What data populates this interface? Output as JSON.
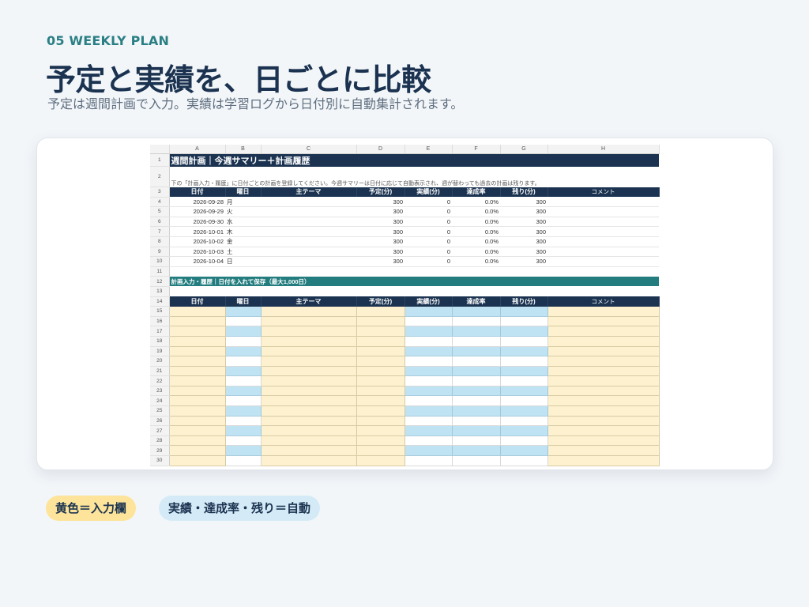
{
  "header": {
    "eyebrow": "05  WEEKLY PLAN",
    "title": "予定と実績を、日ごとに比較",
    "subtitle": "予定は週間計画で入力。実績は学習ログから日付別に自動集計されます。"
  },
  "sheet": {
    "column_letters": [
      "A",
      "B",
      "C",
      "D",
      "E",
      "F",
      "G",
      "H"
    ],
    "title_row": "週間計画｜今週サマリー＋計画履歴",
    "note_row": "下の「計画入力・履歴」に日付ごとの計画を登録してください。今週サマリーは日付に応じて自動表示され、週が替わっても過去の計画は残ります。",
    "table_headers": [
      "日付",
      "曜日",
      "主テーマ",
      "予定(分)",
      "実績(分)",
      "達成率",
      "残り(分)",
      "コメント"
    ],
    "summary_rows": [
      {
        "row": "4",
        "date": "2026-09-28",
        "day": "月",
        "theme": "",
        "plan": "300",
        "actual": "0",
        "rate": "0.0%",
        "remain": "300",
        "comment": ""
      },
      {
        "row": "5",
        "date": "2026-09-29",
        "day": "火",
        "theme": "",
        "plan": "300",
        "actual": "0",
        "rate": "0.0%",
        "remain": "300",
        "comment": ""
      },
      {
        "row": "6",
        "date": "2026-09-30",
        "day": "水",
        "theme": "",
        "plan": "300",
        "actual": "0",
        "rate": "0.0%",
        "remain": "300",
        "comment": ""
      },
      {
        "row": "7",
        "date": "2026-10-01",
        "day": "木",
        "theme": "",
        "plan": "300",
        "actual": "0",
        "rate": "0.0%",
        "remain": "300",
        "comment": ""
      },
      {
        "row": "8",
        "date": "2026-10-02",
        "day": "金",
        "theme": "",
        "plan": "300",
        "actual": "0",
        "rate": "0.0%",
        "remain": "300",
        "comment": ""
      },
      {
        "row": "9",
        "date": "2026-10-03",
        "day": "土",
        "theme": "",
        "plan": "300",
        "actual": "0",
        "rate": "0.0%",
        "remain": "300",
        "comment": ""
      },
      {
        "row": "10",
        "date": "2026-10-04",
        "day": "日",
        "theme": "",
        "plan": "300",
        "actual": "0",
        "rate": "0.0%",
        "remain": "300",
        "comment": ""
      }
    ],
    "section_title": "計画入力・履歴｜日付を入れて保存（最大1,000日）",
    "input_row_start": 15,
    "input_row_end": 30
  },
  "legend": {
    "input_label": "黄色＝入力欄",
    "auto_label": "実績・達成率・残り＝自動"
  },
  "colors": {
    "navy": "#1b3350",
    "teal": "#237d7f",
    "input_yellow": "#fdf1cf",
    "auto_blue": "#bfe3f3"
  }
}
